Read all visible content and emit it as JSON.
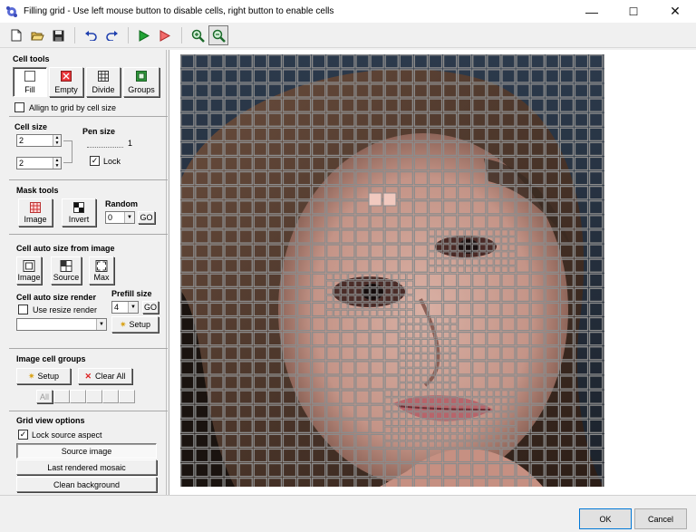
{
  "window": {
    "title": "Filling grid - Use left mouse button to disable cells, right button to enable cells",
    "minimize": "—",
    "maximize": "☐",
    "close": "✕"
  },
  "toolbar": {
    "icons": [
      "new-icon",
      "open-folder-icon",
      "save-icon",
      "undo-icon",
      "redo-icon",
      "run-green-icon",
      "run-red-icon",
      "zoom-in-icon",
      "zoom-fit-icon"
    ]
  },
  "cell_tools": {
    "title": "Cell tools",
    "fill": "Fill",
    "empty": "Empty",
    "divide": "Divide",
    "groups": "Groups",
    "align_label": "Allign to grid by cell size"
  },
  "cell_size": {
    "title": "Cell size",
    "value1": "2",
    "value2": "2",
    "pen_title": "Pen size",
    "pen_value": "1",
    "lock": "Lock"
  },
  "mask_tools": {
    "title": "Mask tools",
    "image": "Image",
    "invert": "Invert",
    "random_title": "Random",
    "random_value": "0",
    "go": "GO"
  },
  "auto_size": {
    "title": "Cell auto size from image",
    "image": "Image",
    "source": "Source",
    "max": "Max",
    "render_title": "Cell auto size render",
    "prefill_title": "Prefill size",
    "prefill_value": "4",
    "go": "GO",
    "use_resize": "Use resize render",
    "render_select": "",
    "setup": "Setup"
  },
  "image_groups": {
    "title": "Image cell groups",
    "setup": "Setup",
    "clear_all": "Clear All",
    "all": "All"
  },
  "grid_view": {
    "title": "Grid view options",
    "lock_aspect": "Lock source aspect",
    "source_image": "Source image",
    "last_rendered": "Last rendered mosaic",
    "clean_background": "Clean background"
  },
  "buttons": {
    "ok": "OK",
    "cancel": "Cancel"
  },
  "colors": {
    "accent": "#0078d7",
    "grid_line": "#8c8c8c",
    "bg_dark": "#2b3442",
    "skin": "#c9a092"
  }
}
